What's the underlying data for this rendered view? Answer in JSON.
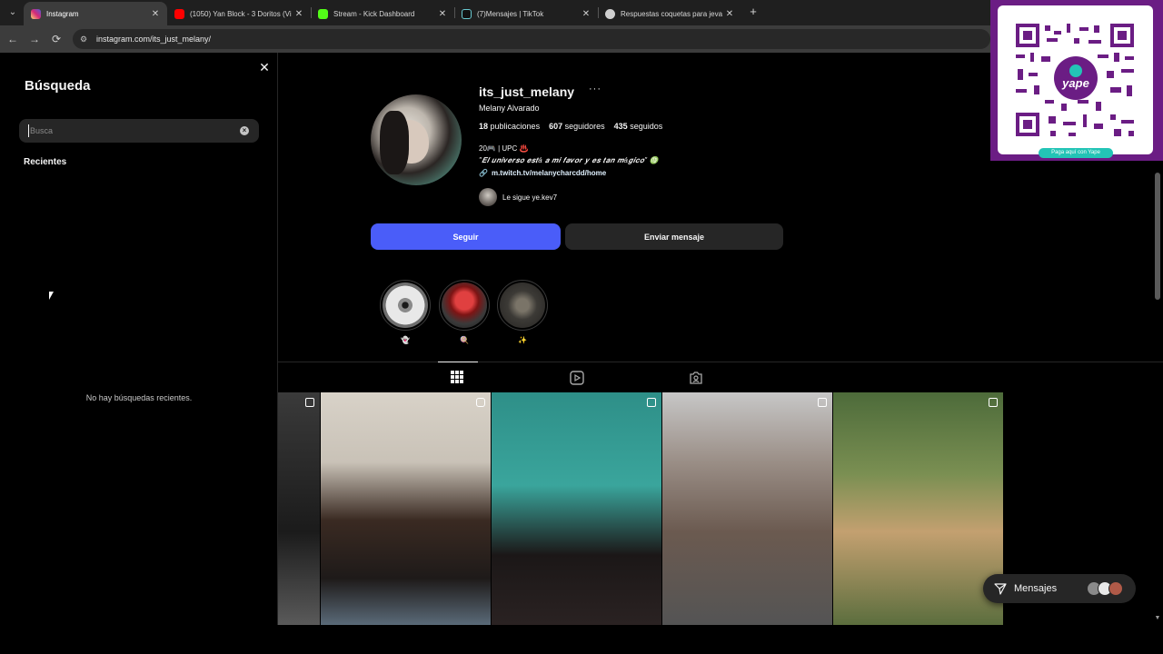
{
  "browser": {
    "tabs": [
      {
        "title": "Instagram",
        "active": true,
        "favicon_color": "#e1306c"
      },
      {
        "title": "(1050) Yan Block - 3 Doritos (Vi",
        "active": false,
        "favicon_color": "#ff0000"
      },
      {
        "title": "Stream - Kick Dashboard",
        "active": false,
        "favicon_color": "#53fc18"
      },
      {
        "title": "(7)Mensajes | TikTok",
        "active": false,
        "favicon_color": "#ffffff"
      },
      {
        "title": "Respuestas coquetas para jeva",
        "active": false,
        "favicon_color": "#cfcfcf"
      }
    ],
    "url": "instagram.com/its_just_melany/"
  },
  "search_panel": {
    "title": "Búsqueda",
    "placeholder": "Busca",
    "recent_label": "Recientes",
    "empty_text": "No hay búsquedas recientes."
  },
  "profile": {
    "username": "its_just_melany",
    "full_name": "Melany Alvarado",
    "stats": {
      "posts_count": "18",
      "posts_label": "publicaciones",
      "followers_count": "607",
      "followers_label": "seguidores",
      "following_count": "435",
      "following_label": "seguidos"
    },
    "bio_line1": "20🎮 | UPC ♨️",
    "bio_line2": "\"𝑬𝒍 𝒖𝒏𝒊𝒗𝒆𝒓𝒔𝒐 𝒆𝒔𝒕á 𝒂 𝒎𝒊 𝒇𝒂𝒗𝒐𝒓 𝒚 𝒆𝒔 𝒕𝒂𝒏 𝒎á𝒈𝒊𝒄𝒐\" ♍",
    "link": "m.twitch.tv/melanycharcdd/home",
    "followed_by": "Le sigue ye.kev7",
    "follow_button": "Seguir",
    "message_button": "Enviar mensaje",
    "highlights": [
      {
        "label": "👻",
        "color": "#cfcfcf"
      },
      {
        "label": "🍭",
        "color": "#8b1a1a"
      },
      {
        "label": "✨",
        "color": "#3c3a36"
      }
    ]
  },
  "messages_pill": {
    "label": "Mensajes"
  },
  "qr": {
    "caption": "Paga aquí con Yape"
  }
}
